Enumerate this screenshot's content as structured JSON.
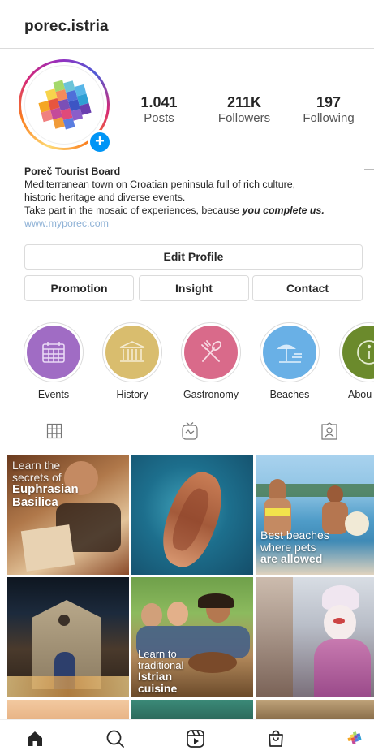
{
  "header": {
    "username": "porec.istria"
  },
  "profile": {
    "avatar_icon": "mosaic-logo-icon",
    "add_story_icon": "plus-icon",
    "stats": {
      "posts": {
        "value": "1.041",
        "label": "Posts"
      },
      "followers": {
        "value": "211K",
        "label": "Followers"
      },
      "following": {
        "value": "197",
        "label": "Following"
      }
    }
  },
  "bio": {
    "name": "Poreč Tourist Board",
    "line1": "Mediterranean town on Croatian peninsula full of rich culture,",
    "line2": "historic heritage and diverse events.",
    "line3_prefix": "Take part in the mosaic of experiences, because ",
    "line3_emphasis": "you complete us.",
    "website": "www.myporec.com"
  },
  "buttons": {
    "edit_profile": "Edit Profile",
    "promotion": "Promotion",
    "insight": "Insight",
    "contact": "Contact"
  },
  "highlights": [
    {
      "label": "Events",
      "icon": "calendar-icon",
      "color": "#a06cc4"
    },
    {
      "label": "History",
      "icon": "museum-icon",
      "color": "#d9bd6e"
    },
    {
      "label": "Gastronomy",
      "icon": "fork-spoon-icon",
      "color": "#d96a8a"
    },
    {
      "label": "Beaches",
      "icon": "beach-umbrella-icon",
      "color": "#69b0e6"
    },
    {
      "label": "Abou",
      "icon": "info-icon",
      "color": "#6b8a2c"
    }
  ],
  "tabs": [
    {
      "name": "grid",
      "icon": "grid-icon"
    },
    {
      "name": "igtv",
      "icon": "igtv-icon"
    },
    {
      "name": "tagged",
      "icon": "tagged-person-icon"
    }
  ],
  "posts": [
    {
      "caption": [
        "Learn the",
        "secrets of",
        "Euphrasian",
        "Basilica"
      ]
    },
    {
      "caption": []
    },
    {
      "caption": [
        "Best beaches",
        "where pets",
        "are allowed"
      ]
    },
    {
      "caption": []
    },
    {
      "caption": [
        "Learn to",
        "traditional",
        "Istrian",
        "cuisine"
      ]
    },
    {
      "caption": []
    }
  ],
  "bottom_nav": [
    {
      "name": "home",
      "icon": "home-icon"
    },
    {
      "name": "search",
      "icon": "search-icon"
    },
    {
      "name": "reels",
      "icon": "reels-icon"
    },
    {
      "name": "shop",
      "icon": "shopping-bag-icon"
    },
    {
      "name": "profile",
      "icon": "profile-avatar-icon"
    }
  ],
  "colors": {
    "link": "#8fb2d6",
    "accent_blue": "#0095f6",
    "border": "#dbdbdb"
  }
}
